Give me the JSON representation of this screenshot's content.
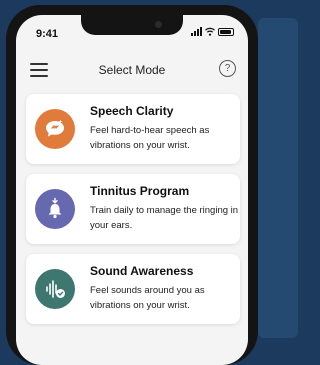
{
  "status_bar": {
    "time": "9:41"
  },
  "header": {
    "title": "Select Mode",
    "help_glyph": "?"
  },
  "modes": [
    {
      "title": "Speech Clarity",
      "description": "Feel hard-to-hear speech as vibrations on your wrist.",
      "icon": "speech-bubble-icon",
      "color": "#e07b3c"
    },
    {
      "title": "Tinnitus Program",
      "description": "Train daily to manage the ringing in your ears.",
      "icon": "bell-download-icon",
      "color": "#6668b0"
    },
    {
      "title": "Sound Awareness",
      "description": "Feel sounds around you as vibrations on your wrist.",
      "icon": "soundwave-check-icon",
      "color": "#3e7770"
    }
  ],
  "colors": {
    "background": "#1c3a5e",
    "screen": "#f4f4f4"
  }
}
